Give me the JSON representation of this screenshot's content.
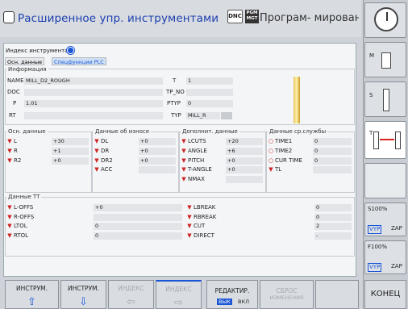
{
  "header": {
    "title": "Расширенное упр. инструментами",
    "dnc": "DNC",
    "pgm_badge": "PGM MGT",
    "mode": "Програм- мирован..."
  },
  "breadcrumb": "Индекс инструмента",
  "tabs": [
    "Осн. данные",
    "Спецфункции PLC"
  ],
  "info": {
    "title": "Информация",
    "name_label": "NAME",
    "name": "MILL_D2_ROUGH",
    "doc_label": "DOC",
    "doc": "",
    "p_label": "P",
    "p": "1.01",
    "rt_label": "RT",
    "rt": "",
    "t_label": "T",
    "t": "1",
    "tpno_label": "TP_NO",
    "tpno": "",
    "ptyp_label": "PTYP",
    "ptyp": "0",
    "typ_label": "TYP",
    "typ": "MILL_R"
  },
  "basic": {
    "title": "Осн. данные",
    "rows": [
      {
        "k": "L",
        "v": "+30"
      },
      {
        "k": "R",
        "v": "+1"
      },
      {
        "k": "R2",
        "v": "+0"
      }
    ]
  },
  "wear": {
    "title": "Данные об износе",
    "rows": [
      {
        "k": "DL",
        "v": "+0"
      },
      {
        "k": "DR",
        "v": "+0"
      },
      {
        "k": "DR2",
        "v": "+0"
      },
      {
        "k": "ACC",
        "v": ""
      }
    ]
  },
  "extra": {
    "title": "Дополнит. данные",
    "rows": [
      {
        "k": "LCUTS",
        "v": "+20"
      },
      {
        "k": "ANGLE",
        "v": "+6"
      },
      {
        "k": "PITCH",
        "v": "+0"
      },
      {
        "k": "T-ANGLE",
        "v": "+0"
      },
      {
        "k": "NMAX",
        "v": ""
      }
    ]
  },
  "life": {
    "title": "Данные ср.службы",
    "rows": [
      {
        "k": "TIME1",
        "v": "0"
      },
      {
        "k": "TIME2",
        "v": "0"
      },
      {
        "k": "CUR TIME",
        "v": "0"
      },
      {
        "k": "TL",
        "v": ""
      }
    ]
  },
  "tt": {
    "title": "Данные TT",
    "left": [
      {
        "k": "L-OFFS",
        "v": "+0"
      },
      {
        "k": "R-OFFS",
        "v": ""
      },
      {
        "k": "LTOL",
        "v": "0"
      },
      {
        "k": "RTOL",
        "v": "0"
      }
    ],
    "right": [
      {
        "k": "LBREAK",
        "v": "0"
      },
      {
        "k": "RBREAK",
        "v": "0"
      },
      {
        "k": "CUT",
        "v": "2"
      },
      {
        "k": "DIRECT",
        "v": "-"
      }
    ]
  },
  "side": {
    "m": "M",
    "s": "S",
    "t": "T",
    "s100": "S100%",
    "f100": "F100%",
    "vyp": "VYP",
    "zap": "ZAP"
  },
  "softkeys": {
    "k1": "ИНСТРУМ.",
    "k2": "ИНСТРУМ.",
    "k3": "ИНДЕКС",
    "k4": "ИНДЕКС",
    "k5": "РЕДАКТИР.",
    "k5a": "ВЫК",
    "k5b": "ВКЛ",
    "k6a": "СБРОС",
    "k6b": "ИЗМЕНЕНИЯ",
    "end": "КОНЕЦ"
  }
}
